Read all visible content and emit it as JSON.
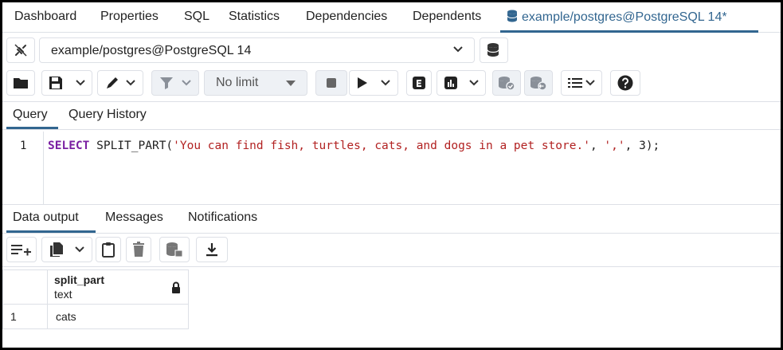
{
  "top_tabs": [
    {
      "label": "Dashboard"
    },
    {
      "label": "Properties"
    },
    {
      "label": "SQL"
    },
    {
      "label": "Statistics"
    },
    {
      "label": "Dependencies"
    },
    {
      "label": "Dependents"
    },
    {
      "label": "example/postgres@PostgreSQL 14*"
    }
  ],
  "connection": {
    "selected": "example/postgres@PostgreSQL 14"
  },
  "toolbar": {
    "limit_label": "No limit"
  },
  "query_tabs": [
    {
      "label": "Query"
    },
    {
      "label": "Query History"
    }
  ],
  "editor": {
    "line_number": "1",
    "keyword": "SELECT",
    "fn": " SPLIT_PART(",
    "str1": "'You can find fish, turtles, cats, and dogs in a pet store.'",
    "sep1": ", ",
    "str2": "','",
    "tail": ", 3);"
  },
  "output_tabs": [
    {
      "label": "Data output"
    },
    {
      "label": "Messages"
    },
    {
      "label": "Notifications"
    }
  ],
  "grid": {
    "columns": [
      {
        "name": "split_part",
        "type": "text"
      }
    ],
    "rows": [
      {
        "num": "1",
        "values": [
          "cats"
        ]
      }
    ]
  },
  "colors": {
    "accent": "#326690",
    "border": "#dde0e6"
  }
}
